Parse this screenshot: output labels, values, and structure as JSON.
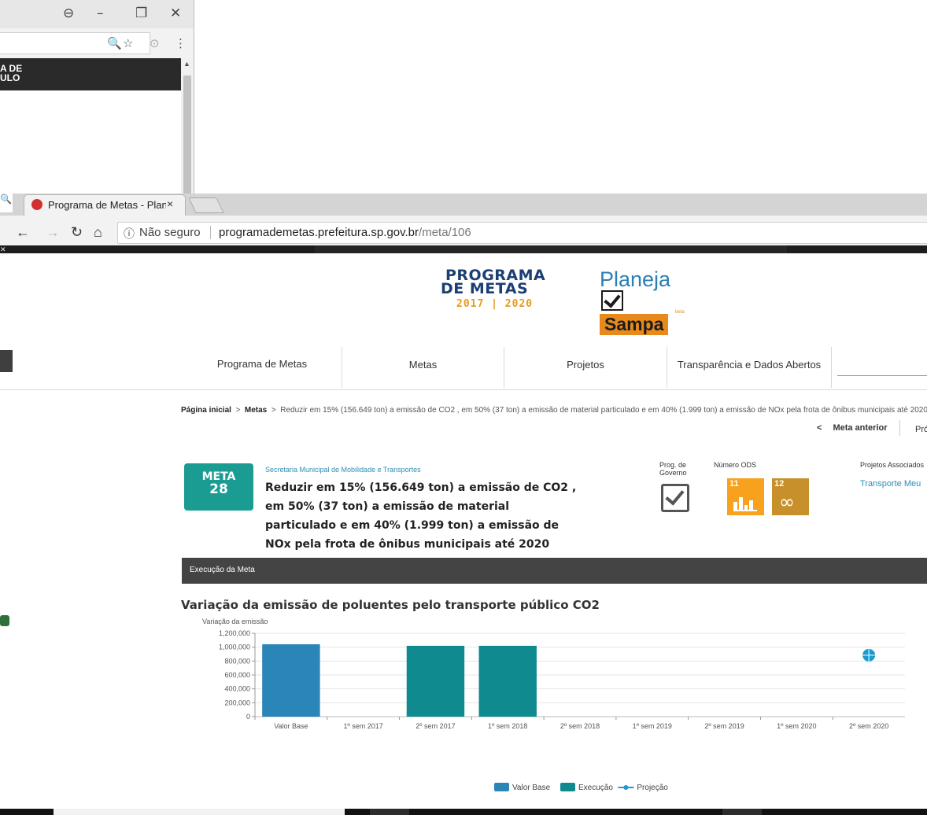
{
  "background_window": {
    "menu_glyphs": [
      "⊖",
      "–",
      "❐",
      "✕"
    ],
    "toolbar_glyphs": [
      "🔍",
      "☆",
      "⊙",
      "⋮"
    ],
    "dark_band_lines": [
      "A DE",
      "ULO"
    ]
  },
  "browser": {
    "tab_title": "Programa de Metas - Plan",
    "tab_close": "×",
    "security_label": "Não seguro",
    "url_host": "programademetas.prefeitura.sp.gov.br",
    "url_path": "/meta/106"
  },
  "header": {
    "logo_programa": {
      "line1": "PROGRAMA",
      "line2": "DE METAS",
      "years": "2017 | 2020"
    },
    "logo_planeja": {
      "top": "Planeja",
      "bottom": "Sampa",
      "beta": "beta"
    }
  },
  "nav": {
    "items": [
      "Programa de Metas",
      "Metas",
      "Projetos",
      "Transparência e Dados Abertos"
    ]
  },
  "breadcrumb": {
    "home": "Página inicial",
    "sep": ">",
    "section": "Metas",
    "current": "Reduzir em 15% (156.649 ton) a emissão de CO2 , em 50% (37 ton) a emissão de material particulado e em 40% (1.999 ton) a emissão de NOx pela frota de ônibus municipais até 2020",
    "prev_label": "Meta anterior",
    "next_label": "Pró"
  },
  "meta": {
    "badge_label": "META",
    "badge_number": "28",
    "secretaria": "Secretaria Municipal de Mobilidade e Transportes",
    "description": "Reduzir em 15% (156.649 ton) a emissão de CO2 , em 50% (37 ton) a emissão de material particulado e em 40% (1.999 ton) a emissão de NOx pela frota de ônibus municipais até 2020",
    "prog_governo_label": "Prog. de Governo",
    "ods_label": "Número ODS",
    "ods": [
      {
        "number": "11",
        "color": "#f7a11c"
      },
      {
        "number": "12",
        "color": "#c8902b"
      }
    ],
    "projetos_label": "Projetos Associados",
    "projeto_link": "Transporte Meu"
  },
  "execucao": {
    "label": "Execução da Meta"
  },
  "chart_data": {
    "type": "bar",
    "title": "Variação da emissão de poluentes pelo transporte público CO2",
    "ylabel": "Variação da emissão",
    "xlabel": "",
    "ylim": [
      0,
      1200000
    ],
    "yticks": [
      "0",
      "200,000",
      "400,000",
      "600,000",
      "800,000",
      "1,000,000",
      "1,200,000"
    ],
    "categories": [
      "Valor Base",
      "1º sem 2017",
      "2º sem 2017",
      "1º sem 2018",
      "2º sem 2018",
      "1º sem 2019",
      "2º sem 2019",
      "1º sem 2020",
      "2º sem 2020"
    ],
    "series": [
      {
        "name": "Valor Base",
        "type": "bar",
        "color": "#2b86b8",
        "values": [
          1042000,
          null,
          null,
          null,
          null,
          null,
          null,
          null,
          null
        ]
      },
      {
        "name": "Execução",
        "type": "bar",
        "color": "#0f8a8f",
        "values": [
          null,
          null,
          1020000,
          1020000,
          null,
          null,
          null,
          null,
          null
        ]
      },
      {
        "name": "Projeção",
        "type": "line",
        "color": "#1a9bd0",
        "values": [
          null,
          null,
          null,
          null,
          null,
          null,
          null,
          null,
          885000
        ]
      }
    ],
    "legend_position": "bottom-center",
    "grid": true
  }
}
